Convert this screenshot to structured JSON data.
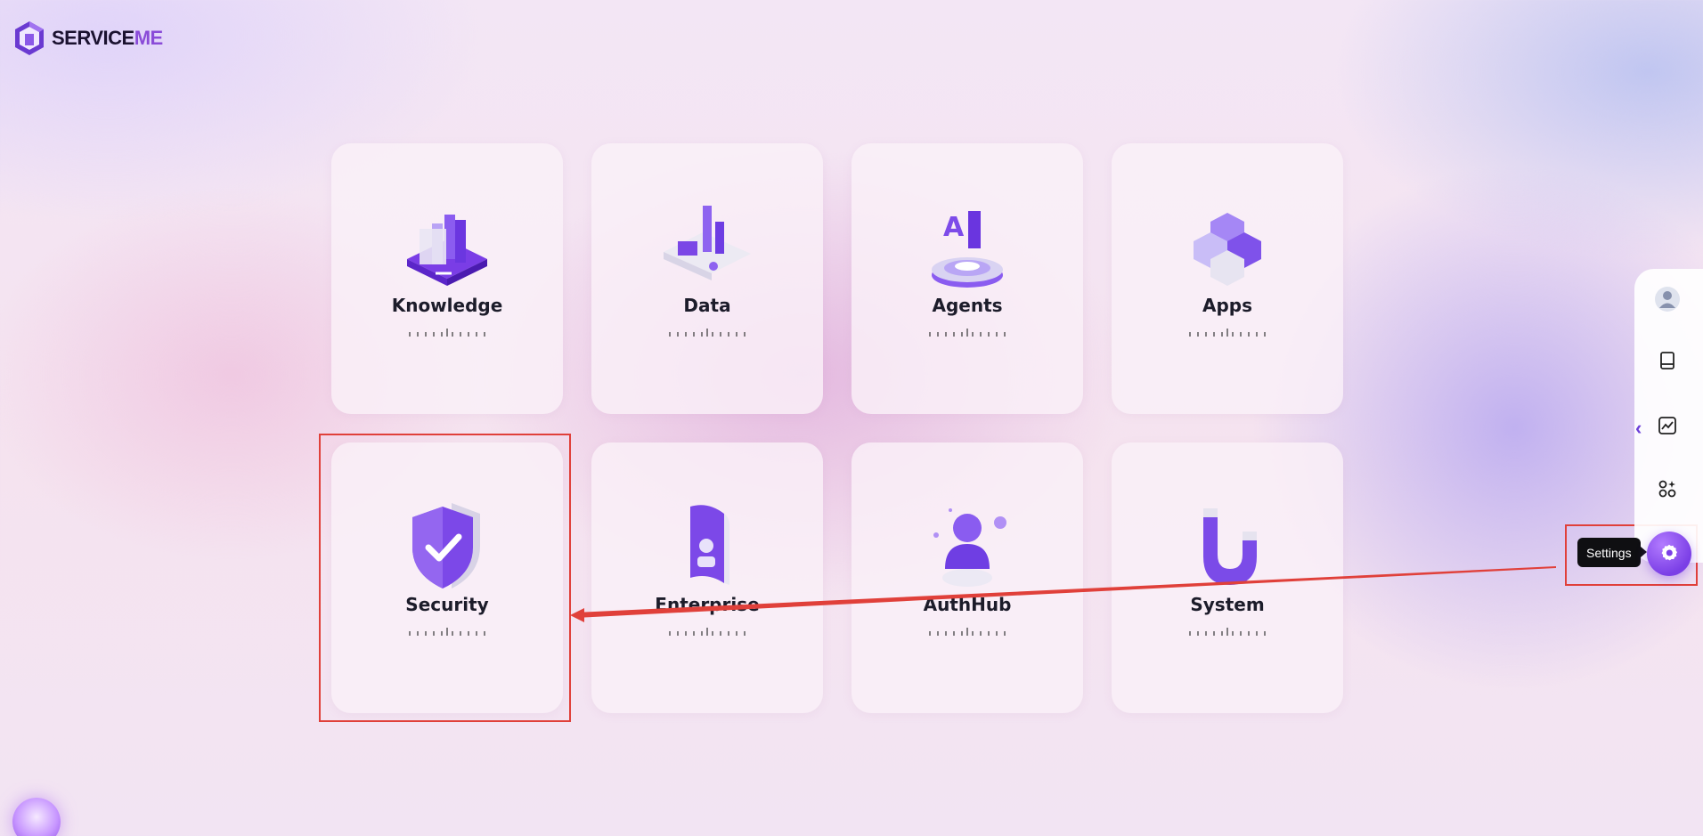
{
  "app": {
    "logo_main": "SERVICE",
    "logo_accent": "ME"
  },
  "cards": [
    {
      "label": "Knowledge"
    },
    {
      "label": "Data"
    },
    {
      "label": "Agents"
    },
    {
      "label": "Apps"
    },
    {
      "label": "Security"
    },
    {
      "label": "Enterprise"
    },
    {
      "label": "AuthHub"
    },
    {
      "label": "System"
    }
  ],
  "sidebar": {
    "items": [
      {
        "icon": "avatar"
      },
      {
        "icon": "book-icon"
      },
      {
        "icon": "chart-icon"
      },
      {
        "icon": "apps-icon"
      },
      {
        "icon": "gear-icon"
      }
    ],
    "collapse_icon": "chevron-left-icon",
    "tooltip": "Settings"
  },
  "colors": {
    "accent": "#7b3fe6",
    "highlight": "#e0403a"
  }
}
